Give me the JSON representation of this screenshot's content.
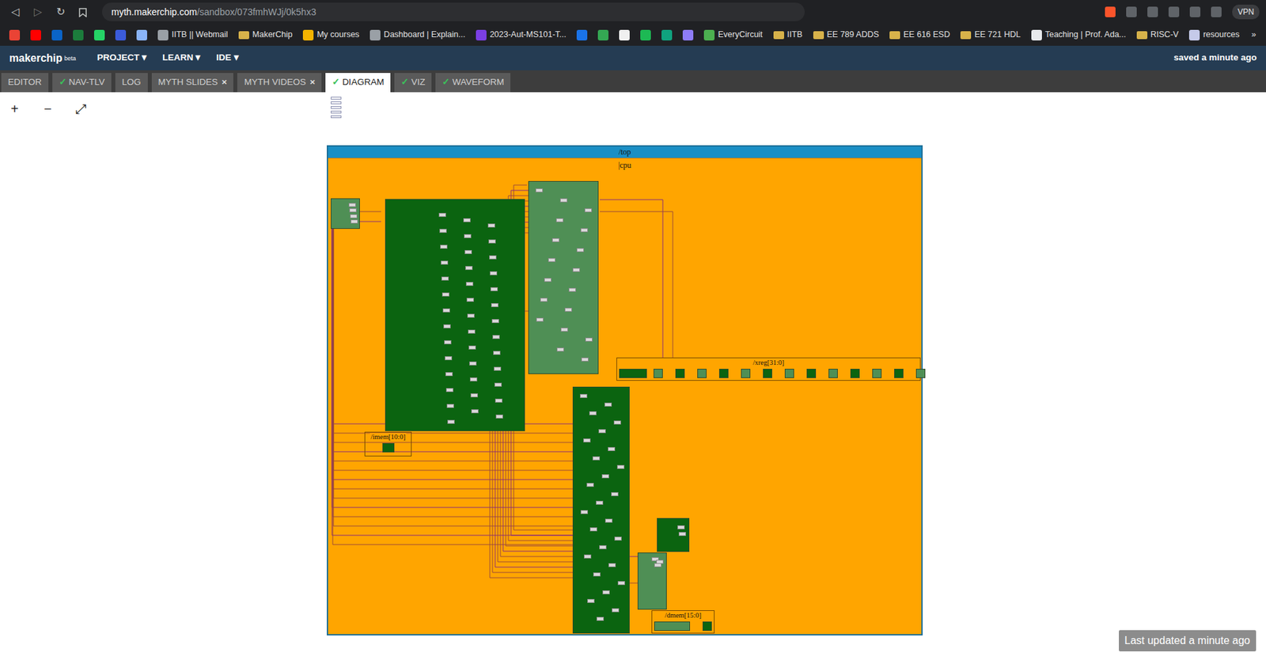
{
  "browser": {
    "back": "◁",
    "forward": "▷",
    "reload": "↻",
    "host": "myth.makerchip.com",
    "path": "/sandbox/073fmhWJj/0k5hx3",
    "vpn": "VPN",
    "bookmarks": [
      {
        "kind": "icon",
        "color": "#ea4335"
      },
      {
        "kind": "icon",
        "color": "#ff0000"
      },
      {
        "kind": "icon",
        "color": "#0a64c8"
      },
      {
        "kind": "icon",
        "color": "#1c7c3c"
      },
      {
        "kind": "icon",
        "color": "#25d366"
      },
      {
        "kind": "icon",
        "color": "#3b5bdb"
      },
      {
        "kind": "icon",
        "color": "#8ab4f8"
      },
      {
        "kind": "link",
        "label": "IITB || Webmail",
        "color": "#9aa0a6"
      },
      {
        "kind": "folder",
        "label": "MakerChip"
      },
      {
        "kind": "link",
        "label": "My courses",
        "color": "#f4b400"
      },
      {
        "kind": "link",
        "label": "Dashboard | Explain...",
        "color": "#9aa0a6"
      },
      {
        "kind": "link",
        "label": "2023-Aut-MS101-T...",
        "color": "#7b3fe4"
      },
      {
        "kind": "icon",
        "color": "#1a73e8"
      },
      {
        "kind": "icon",
        "color": "#34a853"
      },
      {
        "kind": "icon",
        "color": "#f0f0f0"
      },
      {
        "kind": "icon",
        "color": "#1db954"
      },
      {
        "kind": "icon",
        "color": "#10a37f"
      },
      {
        "kind": "icon",
        "color": "#8e7cf8"
      },
      {
        "kind": "link",
        "label": "EveryCircuit",
        "color": "#4caf50"
      },
      {
        "kind": "folder",
        "label": "IITB"
      },
      {
        "kind": "folder",
        "label": "EE 789 ADDS"
      },
      {
        "kind": "folder",
        "label": "EE 616 ESD"
      },
      {
        "kind": "folder",
        "label": "EE 721 HDL"
      },
      {
        "kind": "link",
        "label": "Teaching | Prof. Ada...",
        "color": "#e8eaed"
      },
      {
        "kind": "folder",
        "label": "RISC-V"
      },
      {
        "kind": "link",
        "label": "resources",
        "color": "#c5cae9"
      }
    ],
    "more": "»"
  },
  "app": {
    "logo": "makerchip",
    "logo_sub": "beta",
    "menus": [
      "PROJECT ▾",
      "LEARN ▾",
      "IDE ▾"
    ],
    "status": "saved a minute ago"
  },
  "tabs": [
    {
      "label": "EDITOR",
      "selected": false
    },
    {
      "label": "NAV-TLV",
      "check": "✓",
      "selected": false
    },
    {
      "label": "LOG",
      "selected": false
    },
    {
      "label": "MYTH SLIDES",
      "close": "×",
      "selected": false
    },
    {
      "label": "MYTH VIDEOS",
      "close": "×",
      "selected": false
    },
    {
      "label": "DIAGRAM",
      "check": "✓",
      "selected": true
    },
    {
      "label": "VIZ",
      "check": "✓",
      "selected": false
    },
    {
      "label": "WAVEFORM",
      "check": "✓",
      "selected": false
    }
  ],
  "zoom": [
    "+",
    "−",
    "⤢"
  ],
  "diagram": {
    "top": "/top",
    "cpu": "|cpu",
    "scopes": [
      "/xreg[31:0]",
      "/imem[10:0]",
      "/dmem[15:0]"
    ]
  },
  "footer": "Last updated a minute ago"
}
